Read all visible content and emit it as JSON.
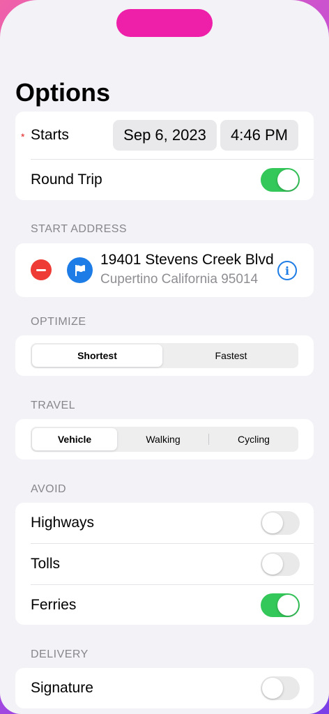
{
  "title": "Options",
  "starts": {
    "label": "Starts",
    "required_marker": "*",
    "date": "Sep 6, 2023",
    "time": "4:46 PM"
  },
  "round_trip": {
    "label": "Round Trip",
    "on": true
  },
  "start_address": {
    "section": "START ADDRESS",
    "street": "19401 Stevens Creek Blvd",
    "city": "Cupertino California 95014"
  },
  "optimize": {
    "section": "OPTIMIZE",
    "options": [
      "Shortest",
      "Fastest"
    ],
    "selected": "Shortest"
  },
  "travel": {
    "section": "TRAVEL",
    "options": [
      "Vehicle",
      "Walking",
      "Cycling"
    ],
    "selected": "Vehicle"
  },
  "avoid": {
    "section": "AVOID",
    "items": [
      {
        "label": "Highways",
        "on": false
      },
      {
        "label": "Tolls",
        "on": false
      },
      {
        "label": "Ferries",
        "on": true
      }
    ]
  },
  "delivery": {
    "section": "DELIVERY",
    "items": [
      {
        "label": "Signature",
        "on": false
      }
    ]
  },
  "icons": {
    "remove": "minus-circle-icon",
    "flag": "flag-icon",
    "info": "info-icon"
  },
  "colors": {
    "accent": "#1d7ce5",
    "toggle_on": "#34c759",
    "remove": "#ef3b35",
    "island": "#ee1fa8"
  }
}
